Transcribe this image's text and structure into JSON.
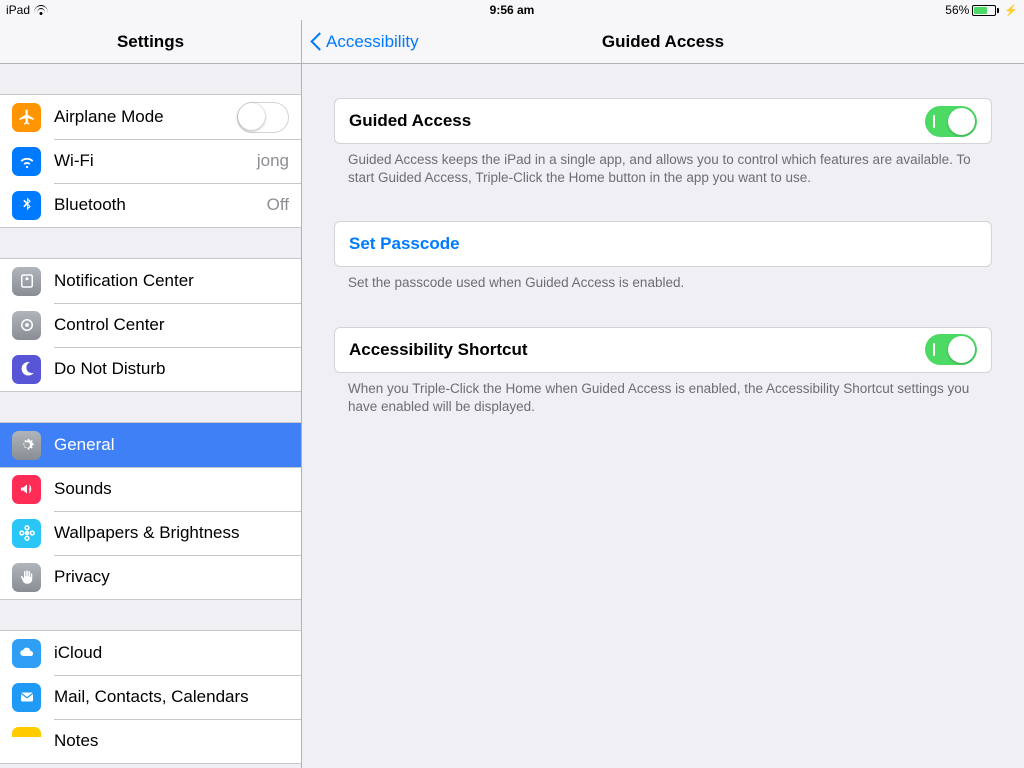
{
  "status_bar": {
    "device": "iPad",
    "time": "9:56 am",
    "battery_pct": "56%"
  },
  "nav": {
    "sidebar_title": "Settings",
    "back_label": "Accessibility",
    "detail_title": "Guided Access"
  },
  "sidebar": {
    "g1": [
      {
        "label": "Airplane Mode",
        "value": ""
      },
      {
        "label": "Wi-Fi",
        "value": "jong"
      },
      {
        "label": "Bluetooth",
        "value": "Off"
      }
    ],
    "g2": [
      {
        "label": "Notification Center"
      },
      {
        "label": "Control Center"
      },
      {
        "label": "Do Not Disturb"
      }
    ],
    "g3": [
      {
        "label": "General"
      },
      {
        "label": "Sounds"
      },
      {
        "label": "Wallpapers & Brightness"
      },
      {
        "label": "Privacy"
      }
    ],
    "g4": [
      {
        "label": "iCloud"
      },
      {
        "label": "Mail, Contacts, Calendars"
      },
      {
        "label": "Notes"
      }
    ]
  },
  "detail": {
    "ga_label": "Guided Access",
    "ga_footer": "Guided Access keeps the iPad in a single app, and allows you to control which features are available. To start Guided Access, Triple-Click the Home button in the app you want to use.",
    "passcode_label": "Set Passcode",
    "passcode_footer": "Set the passcode used when Guided Access is enabled.",
    "shortcut_label": "Accessibility Shortcut",
    "shortcut_footer": "When you Triple-Click the Home when Guided Access is enabled, the Accessibility Shortcut settings you have enabled will be displayed."
  }
}
